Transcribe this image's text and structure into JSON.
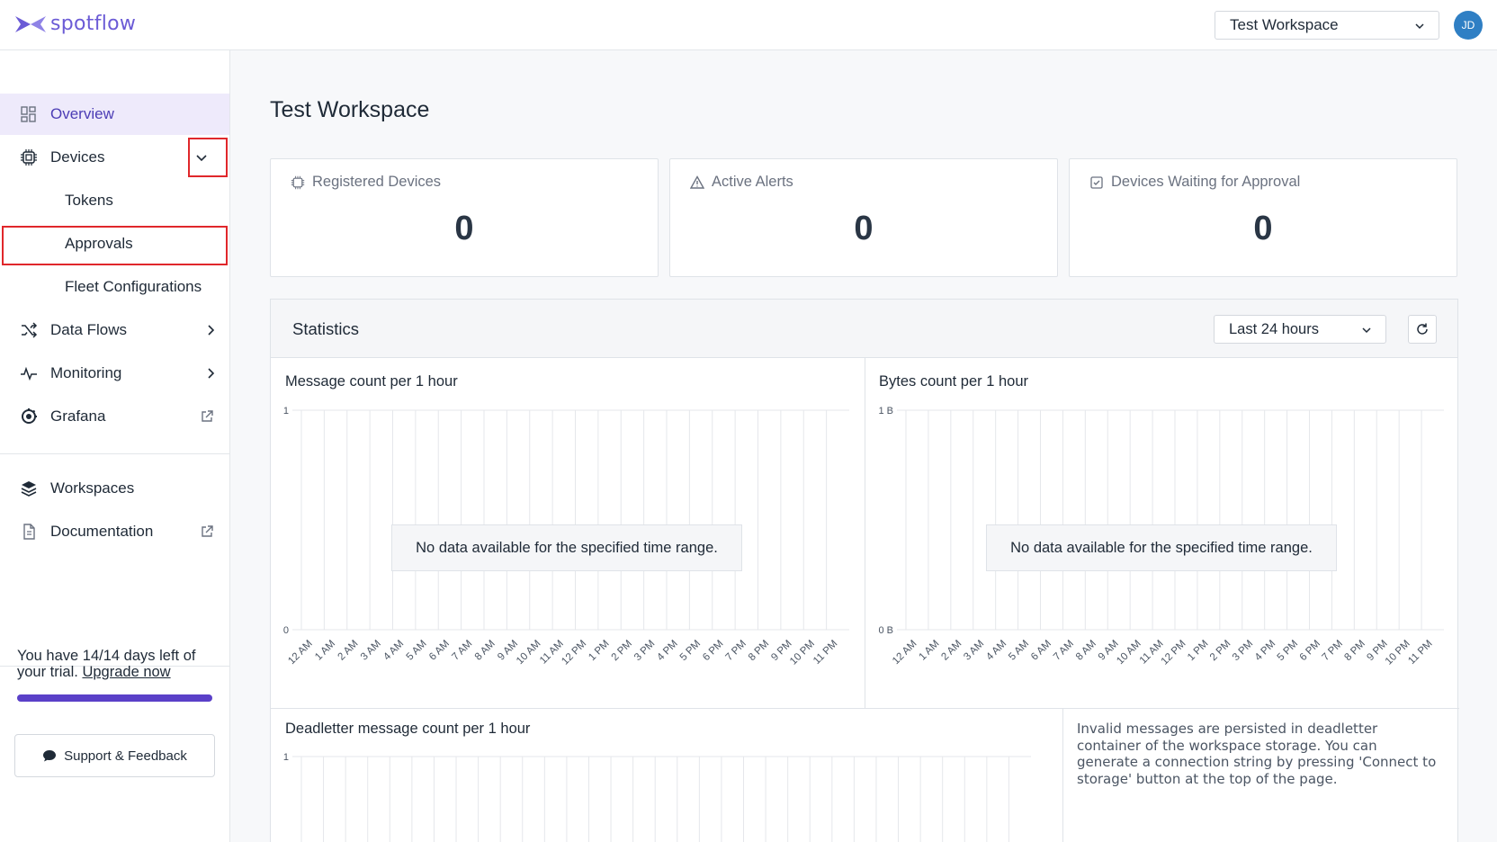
{
  "header": {
    "logo_text": "spotflow",
    "workspace_select": "Test Workspace",
    "avatar_initials": "JD"
  },
  "sidebar": {
    "items": [
      {
        "label": "Overview",
        "icon": "grid-icon",
        "active": true
      },
      {
        "label": "Devices",
        "icon": "chip-icon",
        "expand": "chevron-down-icon"
      },
      {
        "label": "Tokens",
        "sub": true
      },
      {
        "label": "Approvals",
        "sub": true
      },
      {
        "label": "Fleet Configurations",
        "sub": true
      },
      {
        "label": "Data Flows",
        "icon": "shuffle-icon",
        "expand": "chevron-right-icon"
      },
      {
        "label": "Monitoring",
        "icon": "pulse-icon",
        "expand": "chevron-right-icon"
      },
      {
        "label": "Grafana",
        "icon": "grafana-icon",
        "expand": "external-link-icon"
      },
      {
        "label": "Workspaces",
        "icon": "layers-icon"
      },
      {
        "label": "Documentation",
        "icon": "document-icon",
        "expand": "external-link-icon"
      }
    ],
    "trial_text": "You have 14/14 days left of your trial.",
    "upgrade_link": "Upgrade now",
    "trial_progress": 1.0,
    "support_button": "Support & Feedback"
  },
  "main": {
    "title": "Test Workspace",
    "cards": [
      {
        "title": "Registered Devices",
        "value": "0",
        "icon": "chip-icon"
      },
      {
        "title": "Active Alerts",
        "value": "0",
        "icon": "warning-icon"
      },
      {
        "title": "Devices Waiting for Approval",
        "value": "0",
        "icon": "check-square-icon"
      }
    ],
    "statistics": {
      "title": "Statistics",
      "range": "Last 24 hours",
      "no_data": "No data available for the specified time range.",
      "info": "Invalid messages are persisted in deadletter container of the workspace storage. You can generate a connection string by pressing 'Connect to storage' button at the top of the page."
    }
  },
  "chart_data": [
    {
      "type": "bar",
      "title": "Message count per 1 hour",
      "categories": [
        "12 AM",
        "1 AM",
        "2 AM",
        "3 AM",
        "4 AM",
        "5 AM",
        "6 AM",
        "7 AM",
        "8 AM",
        "9 AM",
        "10 AM",
        "11 AM",
        "12 PM",
        "1 PM",
        "2 PM",
        "3 PM",
        "4 PM",
        "5 PM",
        "6 PM",
        "7 PM",
        "8 PM",
        "9 PM",
        "10 PM",
        "11 PM"
      ],
      "values": [],
      "yticks": [
        "1",
        "0"
      ],
      "ylim": [
        0,
        1
      ]
    },
    {
      "type": "bar",
      "title": "Bytes count per 1 hour",
      "categories": [
        "12 AM",
        "1 AM",
        "2 AM",
        "3 AM",
        "4 AM",
        "5 AM",
        "6 AM",
        "7 AM",
        "8 AM",
        "9 AM",
        "10 AM",
        "11 AM",
        "12 PM",
        "1 PM",
        "2 PM",
        "3 PM",
        "4 PM",
        "5 PM",
        "6 PM",
        "7 PM",
        "8 PM",
        "9 PM",
        "10 PM",
        "11 PM"
      ],
      "values": [],
      "yticks": [
        "1 B",
        "0 B"
      ],
      "ylim": [
        0,
        1
      ]
    },
    {
      "type": "bar",
      "title": "Deadletter message count per 1 hour",
      "categories": [],
      "values": [],
      "yticks": [
        "1"
      ],
      "ylim": [
        0,
        1
      ]
    }
  ]
}
